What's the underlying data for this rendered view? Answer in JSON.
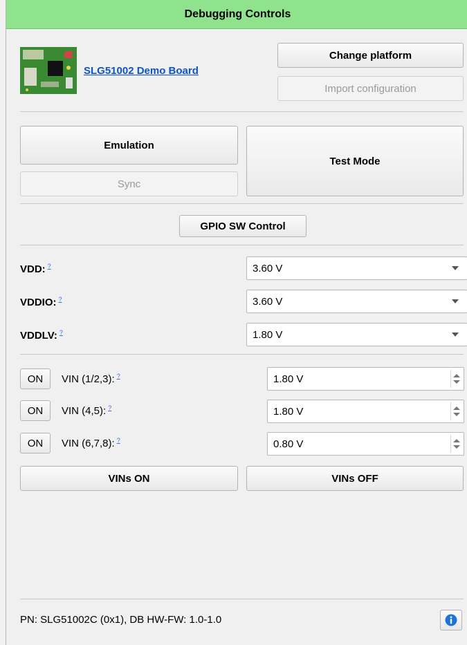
{
  "header": {
    "title": "Debugging Controls"
  },
  "platform": {
    "board_link": "SLG51002 Demo Board",
    "change_platform_label": "Change platform",
    "import_config_label": "Import configuration"
  },
  "modes": {
    "emulation_label": "Emulation",
    "sync_label": "Sync",
    "test_mode_label": "Test Mode",
    "gpio_label": "GPIO SW Control"
  },
  "supplies": [
    {
      "label": "VDD:",
      "value": "3.60 V"
    },
    {
      "label": "VDDIO:",
      "value": "3.60 V"
    },
    {
      "label": "VDDLV:",
      "value": "1.80 V"
    }
  ],
  "vins": [
    {
      "toggle": "ON",
      "label": "VIN (1/2,3):",
      "value": "1.80 V"
    },
    {
      "toggle": "ON",
      "label": "VIN (4,5):",
      "value": "1.80 V"
    },
    {
      "toggle": "ON",
      "label": "VIN (6,7,8):",
      "value": "0.80 V"
    }
  ],
  "vin_actions": {
    "on_label": "VINs ON",
    "off_label": "VINs OFF"
  },
  "help_glyph": "?",
  "footer": {
    "status": "PN: SLG51002C (0x1), DB HW-FW: 1.0-1.0"
  },
  "icons": {
    "info": "info-icon",
    "dropdown": "chevron-down-icon",
    "spinner": "spinner-arrows-icon"
  },
  "colors": {
    "title_bg": "#8fe38c",
    "link": "#0b55c9",
    "info_blue": "#1e73d8"
  }
}
